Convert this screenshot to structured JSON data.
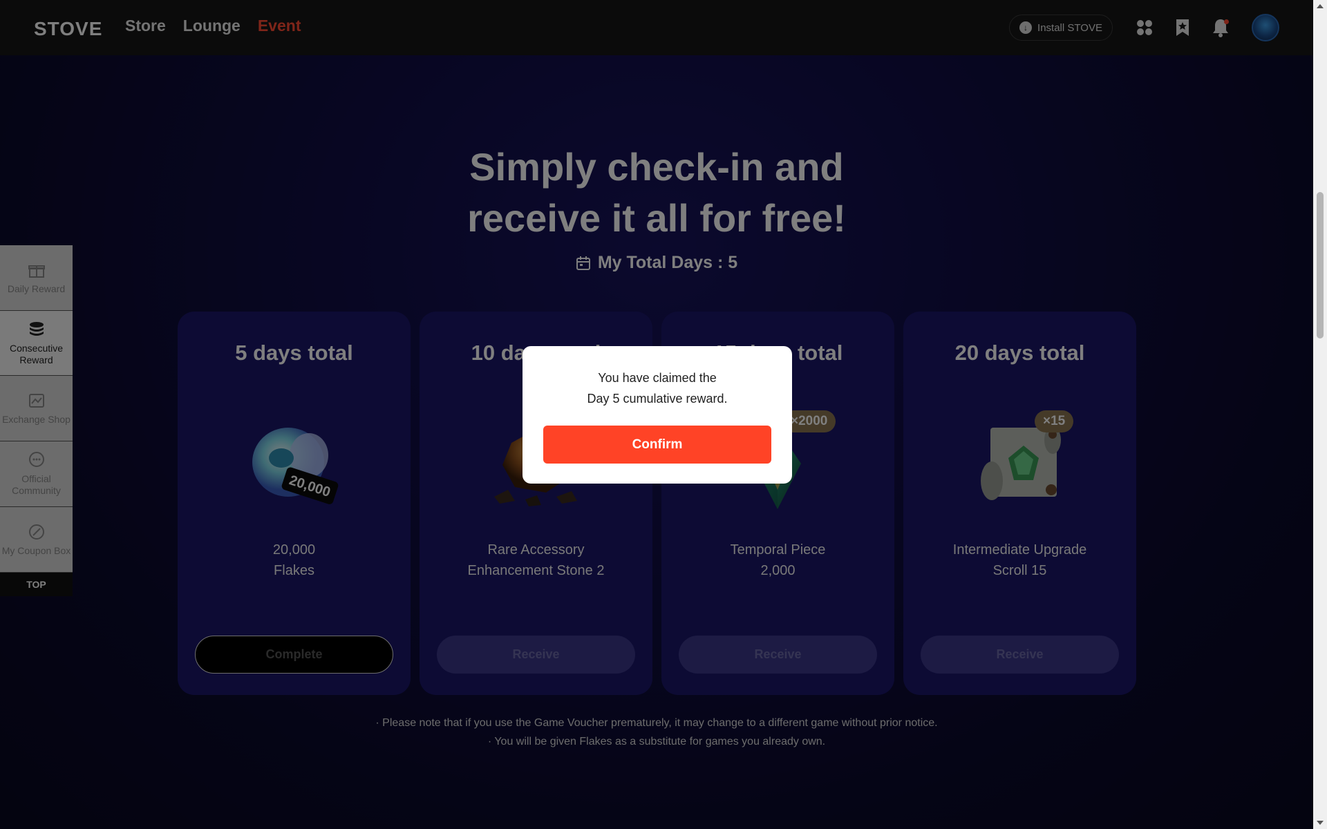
{
  "header": {
    "logo": "STOVE",
    "nav": [
      "Store",
      "Lounge",
      "Event"
    ],
    "active_nav": "Event",
    "install_label": "Install STOVE",
    "icons": [
      "apps-grid-icon",
      "bookmark-star-icon",
      "bell-icon",
      "avatar"
    ]
  },
  "hero": {
    "title_line1": "Simply check-in and",
    "title_line2": "receive it all for free!",
    "total_days": "My Total Days : 5"
  },
  "cards": [
    {
      "title": "5 days total",
      "name": "20,000\nFlakes",
      "button": "Complete",
      "state": "complete",
      "img_label": "20,000"
    },
    {
      "title": "10 days total",
      "name": "Rare Accessory\nEnhancement Stone 2",
      "button": "Receive",
      "state": "disabled"
    },
    {
      "title": "15 days total",
      "name": "Temporal Piece\n2,000",
      "button": "Receive",
      "state": "disabled",
      "badge": "×2000"
    },
    {
      "title": "20 days total",
      "name": "Intermediate Upgrade\nScroll 15",
      "button": "Receive",
      "state": "disabled",
      "badge": "×15"
    }
  ],
  "notes": [
    "· Please note that if you use the Game Voucher prematurely, it may change to a different game without prior notice.",
    "· You will be given Flakes as a substitute for games you already own."
  ],
  "sidebar": {
    "items": [
      {
        "label": "Daily Reward",
        "icon": "gift-icon",
        "active": false
      },
      {
        "label": "Consecutive Reward",
        "icon": "coin-stack-icon",
        "active": true
      },
      {
        "label": "Exchange Shop",
        "icon": "shop-icon",
        "active": false
      },
      {
        "label": "Official Community",
        "icon": "chat-icon",
        "active": false
      },
      {
        "label": "My Coupon Box",
        "icon": "coupon-icon",
        "active": false
      }
    ],
    "top_label": "TOP"
  },
  "modal": {
    "message": "You have claimed the\nDay 5 cumulative reward.",
    "confirm_label": "Confirm"
  },
  "colors": {
    "accent": "#ff4326",
    "card_bg": "#1a1669",
    "page_bg": "#100d45"
  }
}
